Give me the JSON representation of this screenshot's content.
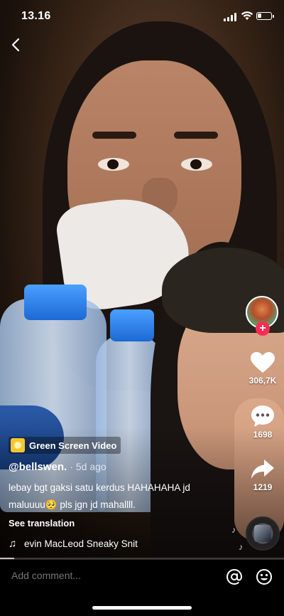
{
  "status_bar": {
    "time": "13.16"
  },
  "video": {
    "effect_label": "Green Screen Video",
    "username": "@bellswen.",
    "age": "· 5d ago",
    "caption_line1": "lebay bgt gaksi satu kerdus HAHAHAHA jd",
    "caption_line2_a": "maluuuu",
    "caption_emoji": "🥺",
    "caption_line2_b": " pls jgn jd mahallll.",
    "see_translation": "See translation",
    "music_text": "evin MacLeod    Sneaky Snit",
    "progress": 0.05
  },
  "actions": {
    "likes": "306,7K",
    "comments": "1698",
    "shares": "1219",
    "follow_symbol": "+"
  },
  "icons": {
    "back": "chevron-left-icon",
    "like": "heart-icon",
    "comment": "comment-bubble-icon",
    "share": "share-arrow-icon",
    "music": "music-note-icon",
    "mention": "at-sign-icon",
    "emoji": "smiley-icon"
  },
  "comment_bar": {
    "placeholder": "Add comment..."
  },
  "colors": {
    "accent": "#fe2c55",
    "effect_badge": "#f7c531"
  }
}
